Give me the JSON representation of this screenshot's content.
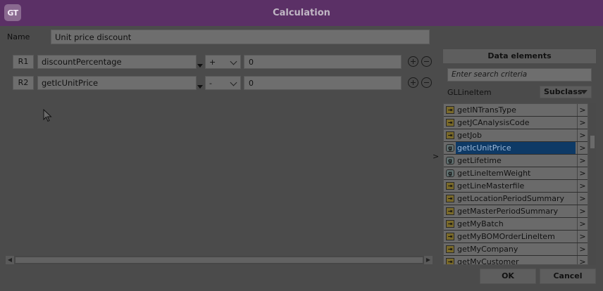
{
  "window": {
    "logo_text": "GT",
    "title": "Calculation"
  },
  "name": {
    "label": "Name",
    "value": "Unit price discount"
  },
  "rows": [
    {
      "id": "R1",
      "field": "discountPercentage",
      "operator": "+",
      "value": "0"
    },
    {
      "id": "R2",
      "field": "getIcUnitPrice",
      "operator": "-",
      "value": "0"
    }
  ],
  "expand_arrow": ">",
  "data_elements": {
    "header": "Data elements",
    "search_placeholder": "Enter search criteria",
    "class_name": "GLLineItem",
    "subclass_label": "Subclass",
    "items": [
      {
        "label": "getINTransType",
        "icon": "method-icon",
        "glyph": "⇥",
        "more": ">"
      },
      {
        "label": "getJCAnalysisCode",
        "icon": "method-icon",
        "glyph": "⇥",
        "more": ">"
      },
      {
        "label": "getJob",
        "icon": "method-icon",
        "glyph": "⇥",
        "more": ">"
      },
      {
        "label": "getIcUnitPrice",
        "icon": "getter-icon",
        "glyph": "g",
        "more": ">",
        "selected": true
      },
      {
        "label": "getLifetime",
        "icon": "getter-icon",
        "glyph": "g",
        "more": ">"
      },
      {
        "label": "getLineItemWeight",
        "icon": "getter-icon",
        "glyph": "g",
        "more": ">"
      },
      {
        "label": "getLineMasterfile",
        "icon": "method-icon",
        "glyph": "⇥",
        "more": ">"
      },
      {
        "label": "getLocationPeriodSummary",
        "icon": "method-icon",
        "glyph": "⇥",
        "more": ">"
      },
      {
        "label": "getMasterPeriodSummary",
        "icon": "method-icon",
        "glyph": "⇥",
        "more": ">"
      },
      {
        "label": "getMyBatch",
        "icon": "method-icon",
        "glyph": "⇥",
        "more": ">"
      },
      {
        "label": "getMyBOMOrderLineItem",
        "icon": "method-icon",
        "glyph": "⇥",
        "more": ">"
      },
      {
        "label": "getMyCompany",
        "icon": "method-icon",
        "glyph": "⇥",
        "more": ">"
      },
      {
        "label": "getMyCustomer",
        "icon": "method-icon",
        "glyph": "⇥",
        "more": ">"
      }
    ]
  },
  "buttons": {
    "ok": "OK",
    "cancel": "Cancel"
  }
}
